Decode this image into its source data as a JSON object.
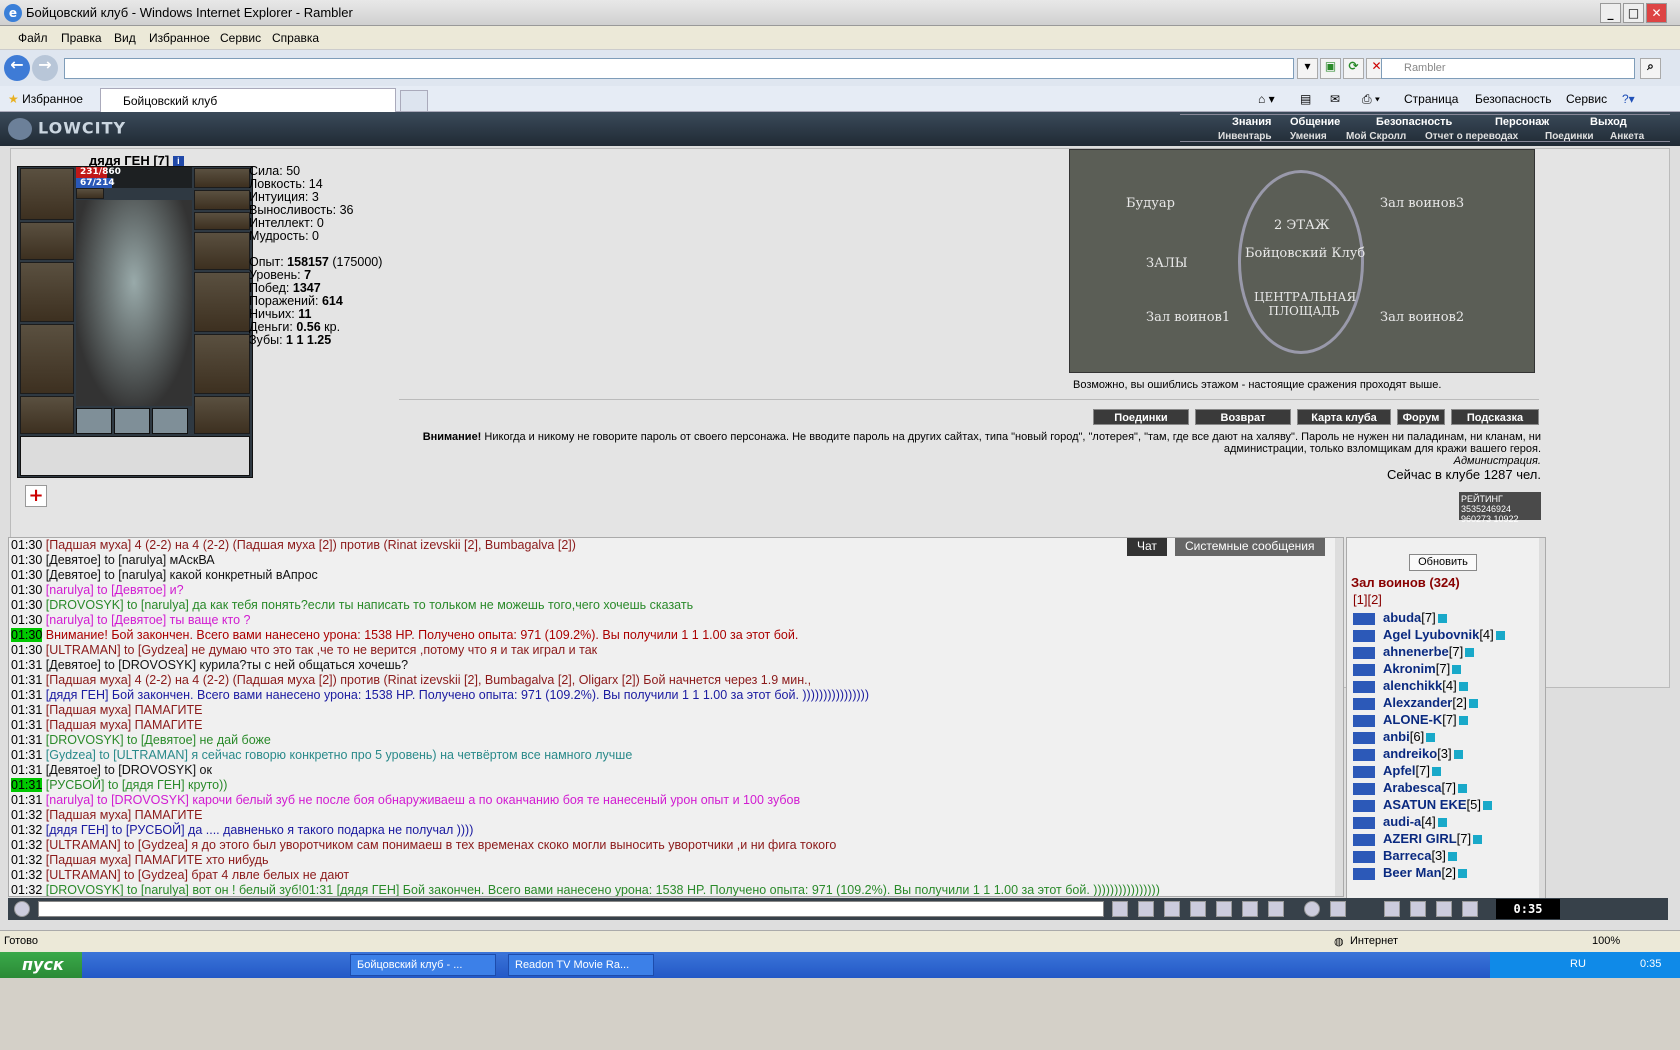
{
  "browser": {
    "title": "Бойцовский клуб - Windows Internet Explorer - Rambler",
    "menu": [
      "Файл",
      "Правка",
      "Вид",
      "Избранное",
      "Сервис",
      "Справка"
    ],
    "search_placeholder": "Rambler",
    "favorites": "Избранное",
    "tab": "Бойцовский клуб",
    "commands": [
      "Страница",
      "Безопасность",
      "Сервис"
    ]
  },
  "game": {
    "logo": "LOWCITY",
    "nav_top": [
      "Знания",
      "Общение",
      "Безопасность",
      "Персонаж",
      "Выход"
    ],
    "nav_bottom": [
      "Инвентарь",
      "Умения",
      "Мой Скролл",
      "Отчет о переводах",
      "Поединки",
      "Анкета"
    ],
    "character": {
      "name": "дядя ГЕН",
      "level": "[7]",
      "hp": "231/860",
      "hp_fraction": 0.27,
      "mp": "67/214",
      "mp_fraction": 0.31
    },
    "stats": [
      {
        "label": "Сила:",
        "value": "50"
      },
      {
        "label": "Ловкость:",
        "value": "14"
      },
      {
        "label": "Интуиция:",
        "value": "3"
      },
      {
        "label": "Выносливость:",
        "value": "36"
      },
      {
        "label": "Интеллект:",
        "value": "0"
      },
      {
        "label": "Мудрость:",
        "value": "0"
      }
    ],
    "info": [
      {
        "label": "Опыт:",
        "value": "158157",
        "extra": "(175000)"
      },
      {
        "label": "Уровень:",
        "value": "7"
      },
      {
        "label": "Побед:",
        "value": "1347"
      },
      {
        "label": "Поражений:",
        "value": "614"
      },
      {
        "label": "Ничьих:",
        "value": "11"
      },
      {
        "label": "Деньги:",
        "value": "0.56",
        "extra": "кр."
      },
      {
        "label": "Зубы:",
        "value": "1 1 1.25"
      }
    ],
    "map": {
      "labels": [
        "Будуар",
        "2 ЭТАЖ",
        "Зал воинов3",
        "Бойцовский Клуб",
        "ЗАЛЫ",
        "ЦЕНТРАЛЬНАЯ ПЛОЩАДЬ",
        "Зал воинов1",
        "Зал воинов2"
      ],
      "note": "Возможно, вы ошиблись этажом - настоящие сражения проходят выше."
    },
    "buttons": [
      "Поединки",
      "Возврат",
      "Карта клуба",
      "Форум",
      "Подсказка"
    ],
    "warning_title": "Внимание!",
    "warning_text": "Никогда и никому не говорите пароль от своего персонажа. Не вводите пароль на других сайтах, типа \"новый город\", \"лотерея\", \"там, где все дают на халяву\". Пароль не нужен ни паладинам, ни кланам, ни администрации, только взломщикам для кражи вашего героя.",
    "admin": "Администрация.",
    "online": "Сейчас в клубе 1287 чел.",
    "counter": "РЕЙТИНГ 3535246924 960273 10922"
  },
  "chat": {
    "tabs": [
      "Чат",
      "Системные сообщения"
    ],
    "lines": [
      {
        "time": "01:30",
        "color": "#8b1a1a",
        "text": "[Падшая муха] 4 (2-2) на 4 (2-2) (Падшая муха [2]) против (Rinat izevskii [2], Bumbagalva [2])"
      },
      {
        "time": "01:30",
        "color": "#111",
        "text": "[Девятое] to [narulya] мАскВА"
      },
      {
        "time": "01:30",
        "color": "#111",
        "text": "[Девятое] to [narulya] какой конкретный вАпрос"
      },
      {
        "time": "01:30",
        "color": "#d11cd1",
        "text": "[narulya] to [Девятое] и?"
      },
      {
        "time": "01:30",
        "color": "#2a8a2a",
        "text": "[DROVOSYK] to [narulya] да как тебя понять?если ты написать то тольком не можешь того,чего хочешь сказать"
      },
      {
        "time": "01:30",
        "color": "#d11cd1",
        "text": "[narulya] to [Девятое] ты ваще кто ?"
      },
      {
        "time": "01:30",
        "color": "#a00",
        "hl": true,
        "text": "Внимание! Бой закончен. Всего вами нанесено урона: 1538 HP. Получено опыта: 971 (109.2%). Вы получили 1 1 1.00 за этот бой."
      },
      {
        "time": "01:30",
        "color": "#8b1a1a",
        "text": "[ULTRAMAN] to [Gydzea] не думаю что это так ,че то не верится ,потому что я и так играл и так"
      },
      {
        "time": "01:31",
        "color": "#111",
        "text": "[Девятое] to [DROVOSYK] курила?ты с ней общаться хочешь?"
      },
      {
        "time": "01:31",
        "color": "#8b1a1a",
        "text": "[Падшая муха] 4 (2-2) на 4 (2-2) (Падшая муха [2]) против (Rinat izevskii [2], Bumbagalva [2], Oligarx [2]) Бой начнется через 1.9 мин.,"
      },
      {
        "time": "01:31",
        "color": "#1a1aa0",
        "text": "[дядя ГЕН] Бой закончен. Всего вами нанесено урона: 1538 HP. Получено опыта: 971 (109.2%). Вы получили 1 1 1.00 за этот бой. ))))))))))))))))"
      },
      {
        "time": "01:31",
        "color": "#8b1a1a",
        "text": "[Падшая муха] ПАМАГИТЕ"
      },
      {
        "time": "01:31",
        "color": "#8b1a1a",
        "text": "[Падшая муха] ПАМАГИТЕ"
      },
      {
        "time": "01:31",
        "color": "#2a8a2a",
        "text": "[DROVOSYK] to [Девятое] не дай боже"
      },
      {
        "time": "01:31",
        "color": "#2a8a8a",
        "text": "[Gydzea] to [ULTRAMAN] я сейчас говорю конкретно про 5 уровень) на четвёртом все намного лучше"
      },
      {
        "time": "01:31",
        "color": "#111",
        "text": "[Девятое] to [DROVOSYK] ок"
      },
      {
        "time": "01:31",
        "color": "#2a8a2a",
        "hl": true,
        "text": "[РУСБОЙ] to [дядя ГЕН] круто))"
      },
      {
        "time": "01:31",
        "color": "#d11cd1",
        "text": "[narulya] to [DROVOSYK] карочи белый зуб не после боя обнаруживаеш а по оканчанию боя те нанесеный урон опыт и 100 зубов"
      },
      {
        "time": "01:32",
        "color": "#8b1a1a",
        "text": "[Падшая муха] ПАМАГИТЕ"
      },
      {
        "time": "01:32",
        "color": "#1a1aa0",
        "text": "[дядя ГЕН] to [РУСБОЙ] да .... давненько я такого подарка не получал ))))"
      },
      {
        "time": "01:32",
        "color": "#8b1a1a",
        "text": "[ULTRAMAN] to [Gydzea] я до этого был уворотчиком сам понимаеш в тех временах скоко могли выносить уворотчики ,и ни фига токого"
      },
      {
        "time": "01:32",
        "color": "#8b1a1a",
        "text": "[Падшая муха] ПАМАГИТЕ хто нибудь"
      },
      {
        "time": "01:32",
        "color": "#8b1a1a",
        "text": "[ULTRAMAN] to [Gydzea] брат 4 лвле белых не дают"
      },
      {
        "time": "01:32",
        "color": "#2a8a2a",
        "text": "[DROVOSYK] to [narulya] вот он ! белый зуб!01:31 [дядя ГЕН] Бой закончен. Всего вами нанесено урона: 1538 HP. Получено опыта: 971 (109.2%). Вы получили 1 1 1.00 за этот бой. ))))))))))))))))"
      }
    ]
  },
  "users": {
    "refresh": "Обновить",
    "hall": "Зал воинов (324)",
    "pages": "[1][2]",
    "list": [
      {
        "name": "abuda",
        "level": "[7]"
      },
      {
        "name": "Agel Lyubovnik",
        "level": "[4]"
      },
      {
        "name": "ahnenerbe",
        "level": "[7]"
      },
      {
        "name": "Akronim",
        "level": "[7]"
      },
      {
        "name": "alenchikk",
        "level": "[4]"
      },
      {
        "name": "Alexzander",
        "level": "[2]"
      },
      {
        "name": "ALONE-K",
        "level": "[7]"
      },
      {
        "name": "anbi",
        "level": "[6]"
      },
      {
        "name": "andreiko",
        "level": "[3]"
      },
      {
        "name": "Apfel",
        "level": "[7]"
      },
      {
        "name": "Arabesca",
        "level": "[7]"
      },
      {
        "name": "ASATUN EKE",
        "level": "[5]"
      },
      {
        "name": "audi-a",
        "level": "[4]"
      },
      {
        "name": "AZERI GIRL",
        "level": "[7]"
      },
      {
        "name": "Barreca",
        "level": "[3]"
      },
      {
        "name": "Beer Man",
        "level": "[2]"
      }
    ]
  },
  "chatbar": {
    "clock": "0:35"
  },
  "status": {
    "ready": "Готово",
    "zone": "Интернет",
    "zoom": "100%"
  },
  "taskbar": {
    "start": "пуск",
    "items": [
      "Бойцовский клуб - ...",
      "Readon TV Movie Ra..."
    ],
    "lang": "RU",
    "time": "0:35"
  }
}
